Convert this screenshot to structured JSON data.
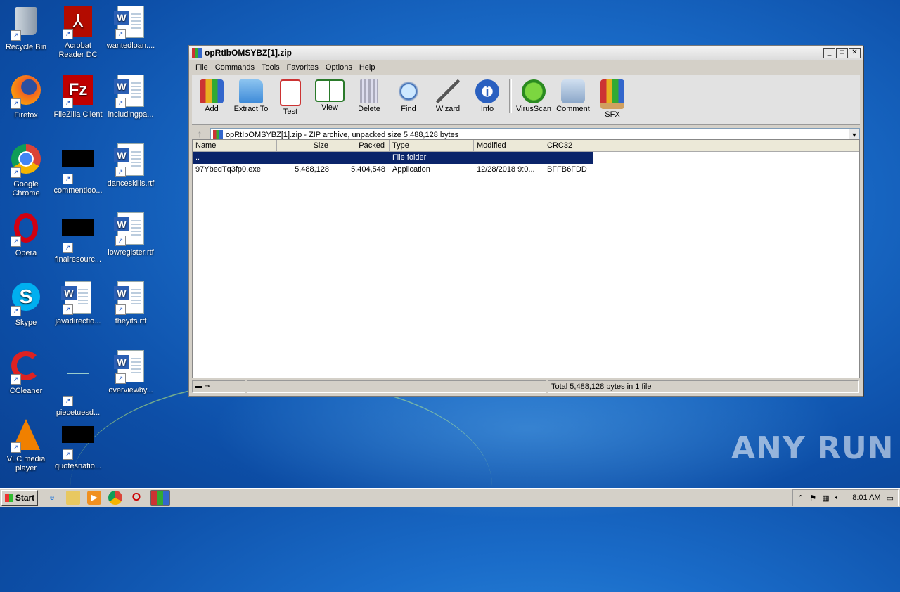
{
  "desktop": {
    "icons": [
      {
        "label": "Recycle Bin"
      },
      {
        "label": "Acrobat\nReader DC"
      },
      {
        "label": "wantedloan...."
      },
      {
        "label": "Firefox"
      },
      {
        "label": "FileZilla Client"
      },
      {
        "label": "includingpa..."
      },
      {
        "label": "Google\nChrome"
      },
      {
        "label": "commentloo..."
      },
      {
        "label": "danceskills.rtf"
      },
      {
        "label": "Opera"
      },
      {
        "label": "finalresourc..."
      },
      {
        "label": "lowregister.rtf"
      },
      {
        "label": "Skype"
      },
      {
        "label": "javadirectio..."
      },
      {
        "label": "theyits.rtf"
      },
      {
        "label": "CCleaner"
      },
      {
        "label": "piecetuesd..."
      },
      {
        "label": "overviewby..."
      },
      {
        "label": "VLC media\nplayer"
      },
      {
        "label": "quotesnatio..."
      }
    ]
  },
  "window": {
    "title": "opRtIbOMSYBZ[1].zip",
    "menu": [
      "File",
      "Commands",
      "Tools",
      "Favorites",
      "Options",
      "Help"
    ],
    "toolbar": [
      "Add",
      "Extract To",
      "Test",
      "View",
      "Delete",
      "Find",
      "Wizard",
      "Info",
      "VirusScan",
      "Comment",
      "SFX"
    ],
    "address": "opRtIbOMSYBZ[1].zip - ZIP archive, unpacked size 5,488,128 bytes",
    "columns": {
      "name": "Name",
      "size": "Size",
      "packed": "Packed",
      "type": "Type",
      "modified": "Modified",
      "crc": "CRC32"
    },
    "rows": [
      {
        "name": "..",
        "size": "",
        "packed": "",
        "type": "File folder",
        "modified": "",
        "crc": ""
      },
      {
        "name": "97YbedTq3fp0.exe",
        "size": "5,488,128",
        "packed": "5,404,548",
        "type": "Application",
        "modified": "12/28/2018 9:0...",
        "crc": "BFFB6FDD"
      }
    ],
    "status_total": "Total 5,488,128 bytes in 1 file"
  },
  "taskbar": {
    "start": "Start",
    "clock": "8:01 AM"
  },
  "watermark": "ANY RUN",
  "colors": {
    "selection": "#0a246a",
    "desktop": "#1a6cc9"
  }
}
